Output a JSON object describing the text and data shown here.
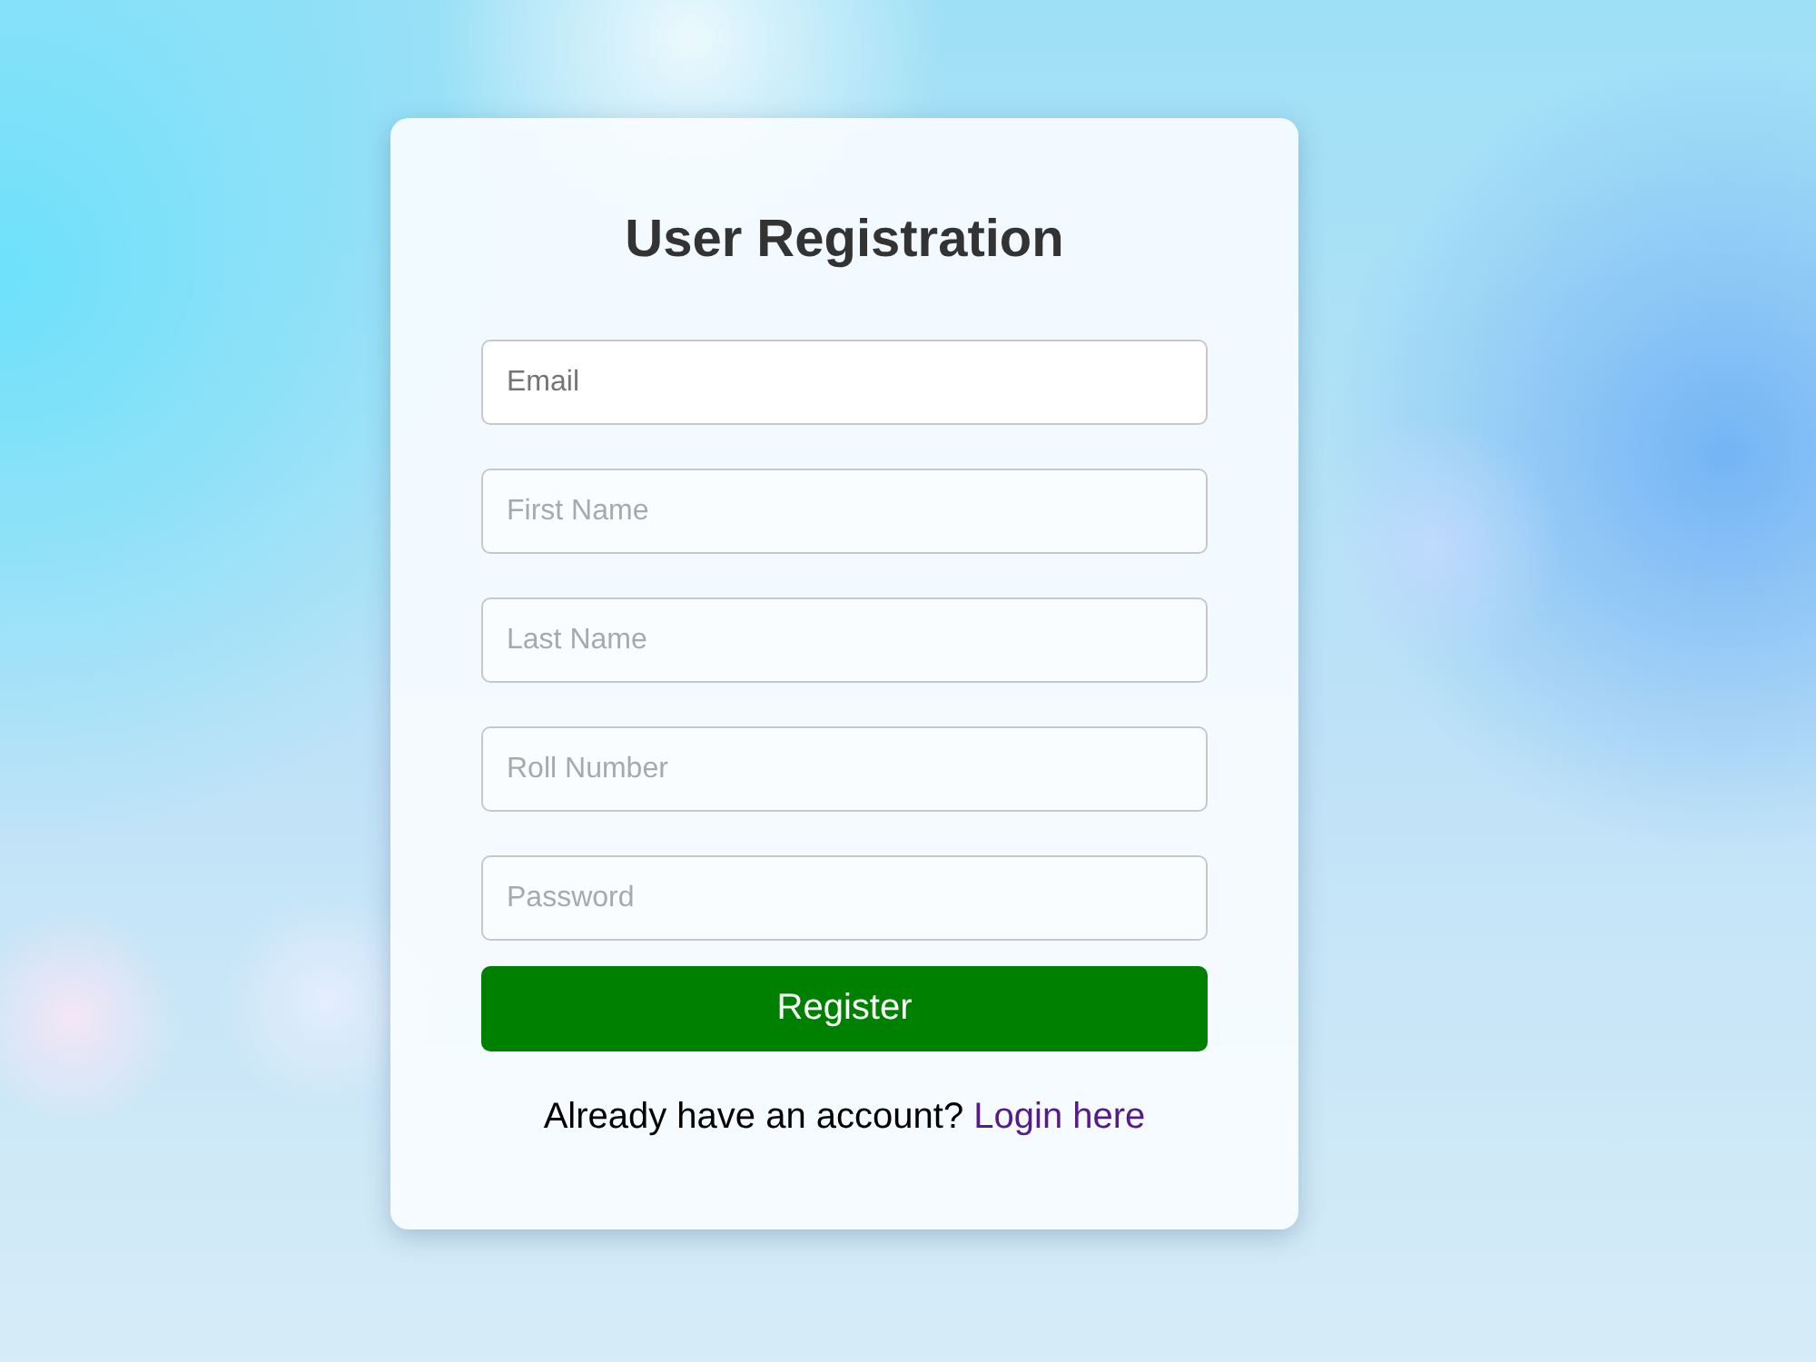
{
  "title": "User Registration",
  "fields": [
    {
      "placeholder": "Email",
      "focused": true
    },
    {
      "placeholder": "First Name",
      "focused": false
    },
    {
      "placeholder": "Last Name",
      "focused": false
    },
    {
      "placeholder": "Roll Number",
      "focused": false
    },
    {
      "placeholder": "Password",
      "focused": false
    }
  ],
  "register_button": "Register",
  "login_prompt": {
    "text": "Already have an account?",
    "link": "Login here"
  }
}
